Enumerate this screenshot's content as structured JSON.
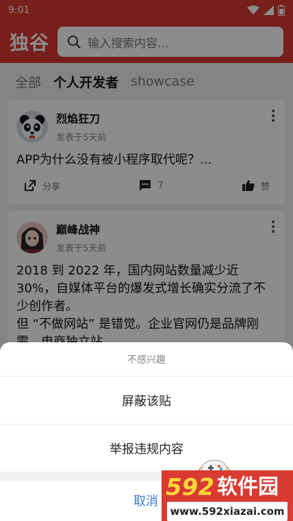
{
  "statusbar": {
    "time": "9:01"
  },
  "header": {
    "logo": "独谷",
    "search_placeholder": "输入搜索内容..."
  },
  "tabs": [
    {
      "label": "全部"
    },
    {
      "label": "个人开发者",
      "active": true
    },
    {
      "label": "showcase"
    }
  ],
  "posts": [
    {
      "author": "烈焰狂刀",
      "time": "发表于5天前",
      "text": "APP为什么没有被小程序取代呢？...",
      "share_label": "分享",
      "comment_count": "7",
      "like_label": "赞"
    },
    {
      "author": "巅峰战神",
      "time": "发表于5天前",
      "text_lines": [
        "2018 到 2022 年，国内网站数量减少近",
        "30%，自媒体平台的爆发式增长确实分流了不",
        "少创作者。",
        "但 “不做网站” 是错觉。企业官网仍是品牌刚",
        "需，电商独立站..."
      ]
    }
  ],
  "sheet": {
    "title": "不感兴趣",
    "items": [
      {
        "label": "屏蔽该贴"
      },
      {
        "label": "举报违规内容"
      }
    ],
    "cancel": "取消"
  },
  "watermark": {
    "number": "592",
    "name": "软件园",
    "url": "www.592xiazai.com"
  },
  "colors": {
    "brand_red": "#d93a32",
    "cancel_blue": "#3a7bd5",
    "watermark_yellow": "#ffd83a"
  }
}
